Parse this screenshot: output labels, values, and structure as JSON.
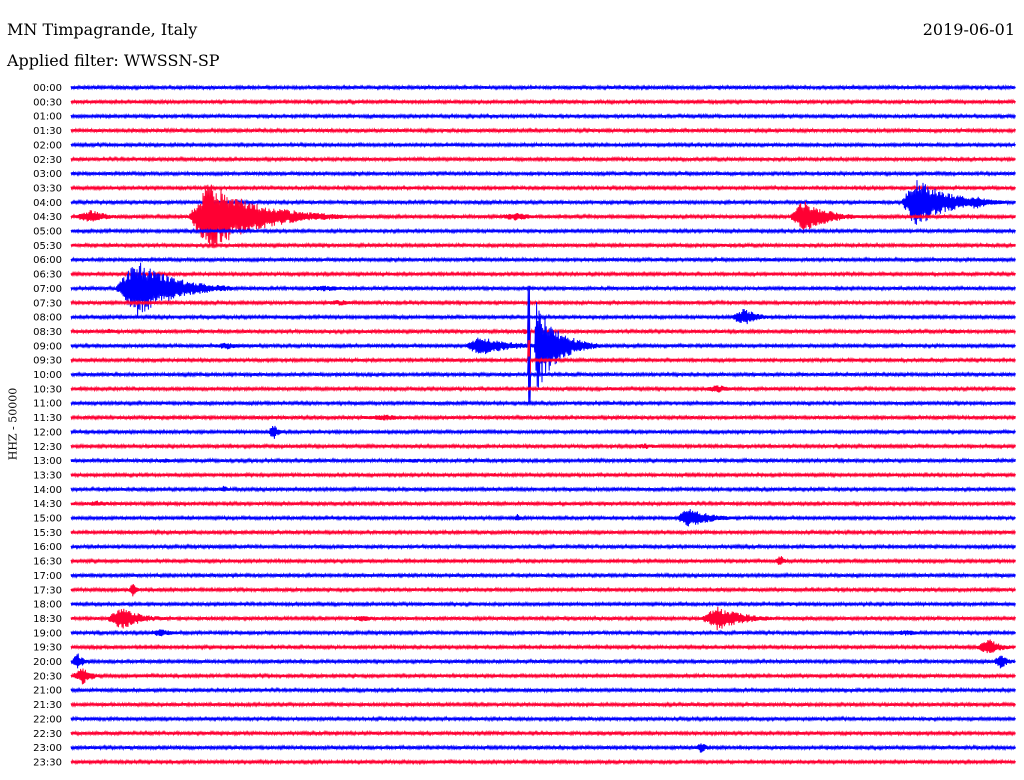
{
  "header": {
    "station": "MN Timpagrande, Italy",
    "filter": "Applied filter: WWSSN-SP",
    "date": "2019-06-01"
  },
  "colors": {
    "even_trace": "#0000ff",
    "odd_trace": "#ff0033"
  },
  "chart_data": {
    "type": "line",
    "title": "MN Timpagrande, Italy",
    "subtitle": "Applied filter: WWSSN-SP",
    "date": "2019-06-01",
    "ylabel": "HHZ - 50000",
    "row_labels": [
      "00:00",
      "00:30",
      "01:00",
      "01:30",
      "02:00",
      "02:30",
      "03:00",
      "03:30",
      "04:00",
      "04:30",
      "05:00",
      "05:30",
      "06:00",
      "06:30",
      "07:00",
      "07:30",
      "08:00",
      "08:30",
      "09:00",
      "09:30",
      "10:00",
      "10:30",
      "11:00",
      "11:30",
      "12:00",
      "12:30",
      "13:00",
      "13:30",
      "14:00",
      "14:30",
      "15:00",
      "15:30",
      "16:00",
      "16:30",
      "17:00",
      "17:30",
      "18:00",
      "18:30",
      "19:00",
      "19:30",
      "20:00",
      "20:30",
      "21:00",
      "21:30",
      "22:00",
      "22:30",
      "23:00",
      "23:30"
    ],
    "row_minutes": 30,
    "noise_level": 1.5,
    "events": [
      {
        "row": 9,
        "start": 0.0,
        "end": 0.06,
        "amp": 7
      },
      {
        "row": 9,
        "start": 0.123,
        "end": 0.29,
        "amp": 35,
        "peak": 0.14
      },
      {
        "row": 9,
        "start": 0.443,
        "end": 0.52,
        "amp": 4
      },
      {
        "row": 9,
        "start": 0.76,
        "end": 0.84,
        "amp": 18,
        "peak": 0.18
      },
      {
        "row": 8,
        "start": 0.878,
        "end": 0.99,
        "amp": 26,
        "peak": 0.14
      },
      {
        "row": 8,
        "start": 0.94,
        "end": 0.99,
        "amp": 7
      },
      {
        "row": 14,
        "start": 0.046,
        "end": 0.17,
        "amp": 30,
        "peak": 0.2
      },
      {
        "row": 14,
        "start": 0.23,
        "end": 0.34,
        "amp": 3
      },
      {
        "row": 15,
        "start": 0.26,
        "end": 0.33,
        "amp": 3
      },
      {
        "row": 12,
        "start": 0.72,
        "end": 0.78,
        "amp": 2
      },
      {
        "row": 16,
        "start": 0.695,
        "end": 0.745,
        "amp": 9
      },
      {
        "row": 17,
        "start": 0.03,
        "end": 0.06,
        "amp": 3
      },
      {
        "row": 17,
        "start": 0.92,
        "end": 0.96,
        "amp": 3
      },
      {
        "row": 18,
        "start": 0.145,
        "end": 0.2,
        "amp": 4
      },
      {
        "row": 18,
        "start": 0.415,
        "end": 0.53,
        "amp": 10,
        "peak": 0.15
      },
      {
        "row": 18,
        "start": 0.49,
        "end": 0.56,
        "amp": 48,
        "peak": 0.04
      },
      {
        "row": 18,
        "start": 0.505,
        "end": 0.5,
        "amp": 0
      },
      {
        "row": 17,
        "start": 0.475,
        "end": 0.49,
        "amp": 3
      },
      {
        "row": 21,
        "start": 0.665,
        "end": 0.72,
        "amp": 4
      },
      {
        "row": 23,
        "start": 0.29,
        "end": 0.41,
        "amp": 3
      },
      {
        "row": 24,
        "start": 0.208,
        "end": 0.225,
        "amp": 9
      },
      {
        "row": 24,
        "start": 0.08,
        "end": 0.13,
        "amp": 1.5
      },
      {
        "row": 25,
        "start": 0.59,
        "end": 0.64,
        "amp": 3
      },
      {
        "row": 26,
        "start": 0.075,
        "end": 0.14,
        "amp": 2.5
      },
      {
        "row": 26,
        "start": 0.345,
        "end": 0.4,
        "amp": 2.5
      },
      {
        "row": 27,
        "start": 0.43,
        "end": 0.48,
        "amp": 2
      },
      {
        "row": 28,
        "start": 0.157,
        "end": 0.17,
        "amp": 5
      },
      {
        "row": 29,
        "start": 0.0,
        "end": 0.08,
        "amp": 3
      },
      {
        "row": 30,
        "start": 0.467,
        "end": 0.48,
        "amp": 5
      },
      {
        "row": 30,
        "start": 0.64,
        "end": 0.72,
        "amp": 11,
        "peak": 0.15
      },
      {
        "row": 33,
        "start": 0.745,
        "end": 0.76,
        "amp": 7
      },
      {
        "row": 35,
        "start": 0.06,
        "end": 0.075,
        "amp": 7
      },
      {
        "row": 37,
        "start": 0.035,
        "end": 0.11,
        "amp": 11,
        "peak": 0.25
      },
      {
        "row": 37,
        "start": 0.28,
        "end": 0.36,
        "amp": 3
      },
      {
        "row": 37,
        "start": 0.665,
        "end": 0.76,
        "amp": 12,
        "peak": 0.2
      },
      {
        "row": 36,
        "start": 0.36,
        "end": 0.42,
        "amp": 2
      },
      {
        "row": 36,
        "start": 0.74,
        "end": 0.8,
        "amp": 2
      },
      {
        "row": 38,
        "start": 0.075,
        "end": 0.13,
        "amp": 4
      },
      {
        "row": 38,
        "start": 0.86,
        "end": 0.93,
        "amp": 3
      },
      {
        "row": 39,
        "start": 0.955,
        "end": 1.0,
        "amp": 9
      },
      {
        "row": 40,
        "start": 0.0,
        "end": 0.02,
        "amp": 9
      },
      {
        "row": 40,
        "start": 0.975,
        "end": 1.0,
        "amp": 8
      },
      {
        "row": 41,
        "start": 0.0,
        "end": 0.035,
        "amp": 9
      },
      {
        "row": 43,
        "start": 0.1,
        "end": 0.15,
        "amp": 1.5
      },
      {
        "row": 43,
        "start": 0.54,
        "end": 0.59,
        "amp": 1.5
      },
      {
        "row": 45,
        "start": 0.48,
        "end": 0.56,
        "amp": 1.5
      },
      {
        "row": 46,
        "start": 0.66,
        "end": 0.68,
        "amp": 6
      },
      {
        "row": 46,
        "start": 0.0,
        "end": 0.06,
        "amp": 2
      },
      {
        "row": 46,
        "start": 0.15,
        "end": 0.22,
        "amp": 1.5
      },
      {
        "row": 11,
        "start": 0.68,
        "end": 0.72,
        "amp": 2
      },
      {
        "row": 11,
        "start": 0.32,
        "end": 0.34,
        "amp": 1.5
      },
      {
        "row": 21,
        "start": 0.55,
        "end": 0.61,
        "amp": 2
      }
    ],
    "spikes": [
      {
        "row": 18,
        "pos": 0.485,
        "up": 60,
        "down": 35
      },
      {
        "row": 17,
        "pos": 0.485,
        "up": 20,
        "down": 20
      },
      {
        "row": 19,
        "pos": 0.485,
        "up": 20,
        "down": 30
      },
      {
        "row": 20,
        "pos": 0.485,
        "up": 18,
        "down": 30
      }
    ]
  }
}
